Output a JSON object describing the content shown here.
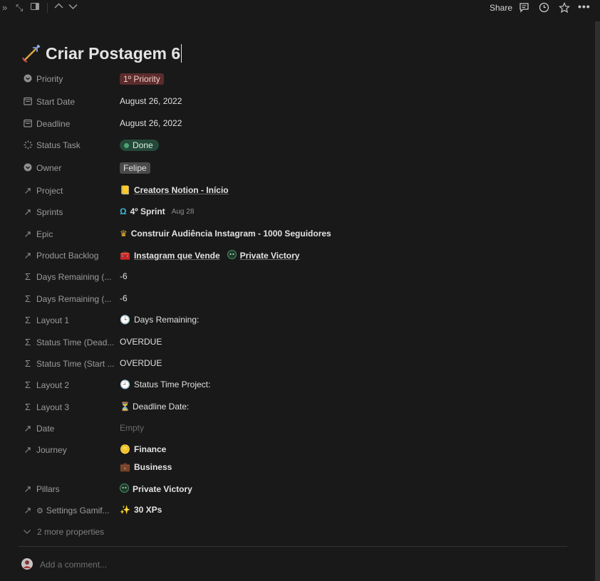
{
  "topbar": {
    "left_icons": [
      "double-chevron-icon",
      "expand-icon",
      "sidebar-icon",
      "chevron-up-icon",
      "chevron-down-icon"
    ],
    "share_label": "Share",
    "right_icons": [
      "comment-icon",
      "history-icon",
      "star-icon",
      "more-icon"
    ]
  },
  "page": {
    "title": "Criar Postagem 6",
    "icon": "arrow-emoji-icon"
  },
  "properties": [
    {
      "label": "Priority",
      "icon": "chevron-circle-icon",
      "value": "1º Priority"
    },
    {
      "label": "Start Date",
      "icon": "calendar-icon",
      "value": "August 26, 2022"
    },
    {
      "label": "Deadline",
      "icon": "calendar-icon",
      "value": "August 26, 2022"
    },
    {
      "label": "Status Task",
      "icon": "status-icon",
      "value": "Done"
    },
    {
      "label": "Owner",
      "icon": "chevron-circle-icon",
      "value": "Felipe"
    },
    {
      "label": "Project",
      "icon": "relation-arrow-icon",
      "value": "Creators Notion - Início"
    },
    {
      "label": "Sprints",
      "icon": "relation-arrow-icon",
      "value": "4º Sprint",
      "extra": "Aug 28"
    },
    {
      "label": "Epic",
      "icon": "relation-arrow-icon",
      "value": "Construir Audiência Instagram - 1000 Seguidores"
    },
    {
      "label": "Product Backlog",
      "icon": "relation-arrow-icon",
      "value": "Instagram que Vende",
      "value2": "Private Victory"
    },
    {
      "label": "Days Remaining (...",
      "icon": "sigma-icon",
      "value": "-6"
    },
    {
      "label": "Days Remaining (...",
      "icon": "sigma-icon",
      "value": "-6"
    },
    {
      "label": "Layout 1",
      "icon": "sigma-icon",
      "value": "Days Remaining:"
    },
    {
      "label": "Status Time (Dead...",
      "icon": "sigma-icon",
      "value": "OVERDUE"
    },
    {
      "label": "Status Time (Start ...",
      "icon": "sigma-icon",
      "value": "OVERDUE"
    },
    {
      "label": "Layout 2",
      "icon": "sigma-icon",
      "value": "Status Time Project:"
    },
    {
      "label": "Layout 3",
      "icon": "sigma-icon",
      "value": "Deadline Date:"
    },
    {
      "label": "Date",
      "icon": "relation-arrow-icon",
      "value": "Empty"
    },
    {
      "label": "Journey",
      "icon": "relation-arrow-icon",
      "value": "Finance",
      "value2": "Business"
    },
    {
      "label": "Pillars",
      "icon": "relation-arrow-icon",
      "value": "Private Victory"
    },
    {
      "label": "Settings Gamif...",
      "icon": "relation-arrow-icon",
      "value": "30 XPs"
    }
  ],
  "more_properties": "2 more properties",
  "comment_placeholder": "Add a comment...",
  "colors": {
    "background": "#191919",
    "priority_tag": "#5c2c2c",
    "done_tag": "#24493a",
    "owner_tag": "#4a4a4a"
  }
}
